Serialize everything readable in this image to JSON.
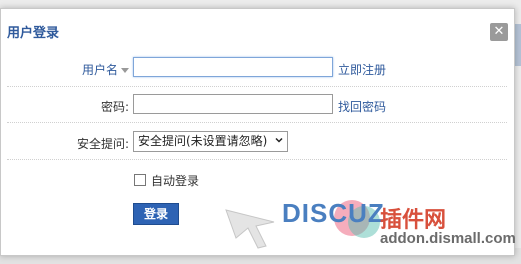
{
  "dialog": {
    "title": "用户登录",
    "close_glyph": "✕"
  },
  "form": {
    "username": {
      "label": "用户名",
      "value": "",
      "link": "立即注册"
    },
    "password": {
      "label": "密码:",
      "value": "",
      "link": "找回密码"
    },
    "security": {
      "label": "安全提问:",
      "selected": "安全提问(未设置请忽略)"
    },
    "autologin": {
      "label": "自动登录",
      "checked": false
    },
    "submit_label": "登录"
  },
  "watermark": {
    "brand": "DISCUZ",
    "cn": "插件网",
    "url": "addon.dismall.com"
  },
  "colors": {
    "accent": "#2f5a9c",
    "button": "#2e63b4",
    "close": "#9a9a9a"
  }
}
